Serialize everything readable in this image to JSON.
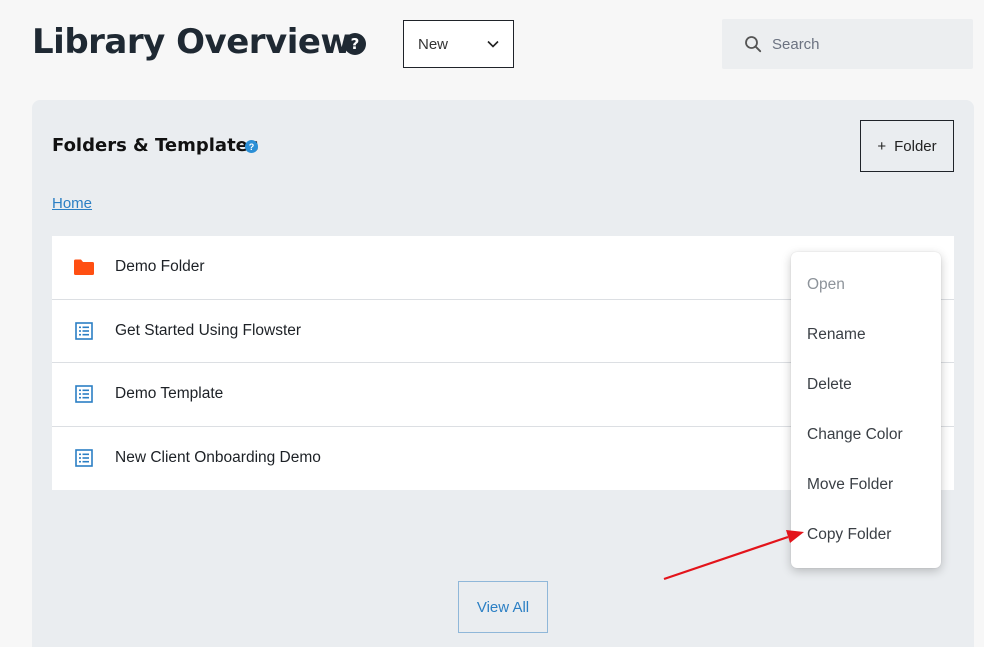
{
  "header": {
    "title": "Library Overview",
    "help_glyph": "?",
    "new_select": {
      "value": "New",
      "icon": "chevron-down-icon"
    },
    "search": {
      "placeholder": "Search",
      "value": "",
      "icon": "search-icon"
    }
  },
  "panel": {
    "title": "Folders & Templates",
    "help_glyph": "?",
    "add_folder_label": "Folder",
    "add_folder_prefix": "+",
    "breadcrumb": "Home",
    "items": [
      {
        "label": "Demo Folder",
        "icon": "folder-icon",
        "icon_color": "#ff4f12"
      },
      {
        "label": "Get Started Using Flowster",
        "icon": "template-icon",
        "icon_color": "#2b7fc4"
      },
      {
        "label": "Demo Template",
        "icon": "template-icon",
        "icon_color": "#2b7fc4"
      },
      {
        "label": "New Client Onboarding Demo",
        "icon": "template-icon",
        "icon_color": "#2b7fc4"
      }
    ],
    "view_all_label": "View All"
  },
  "context_menu": {
    "items": [
      {
        "label": "Open",
        "disabled": true
      },
      {
        "label": "Rename",
        "disabled": false
      },
      {
        "label": "Delete",
        "disabled": false
      },
      {
        "label": "Change Color",
        "disabled": false
      },
      {
        "label": "Move Folder",
        "disabled": false
      },
      {
        "label": "Copy Folder",
        "disabled": false
      }
    ]
  },
  "annotation": {
    "arrow_color": "#e3141b",
    "target": "Copy Folder"
  },
  "colors": {
    "background": "#f7f7f7",
    "panel": "#eaedf0",
    "accent_blue": "#2b7fc4",
    "folder_orange": "#ff4f12"
  }
}
